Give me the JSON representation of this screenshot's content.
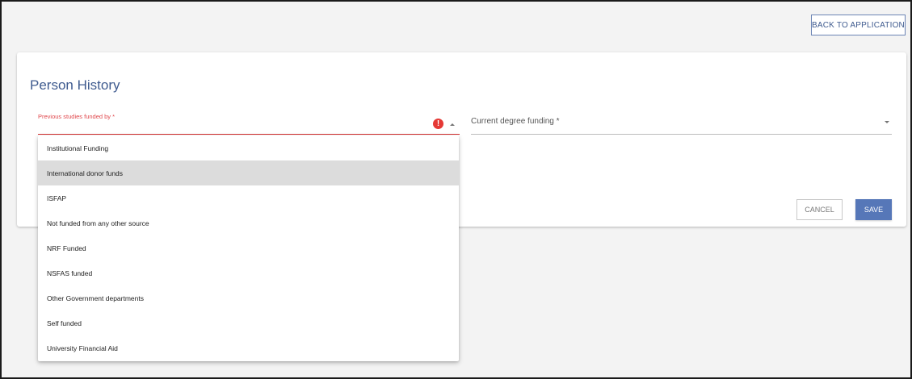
{
  "header": {
    "back_label": "BACK TO APPLICATION"
  },
  "form": {
    "title": "Person History",
    "previous_funding": {
      "label": "Previous studies funded by *",
      "error_icon": "exclamation-icon",
      "options": [
        "Institutional Funding",
        "International donor funds",
        "ISFAP",
        "Not funded from any other source",
        "NRF Funded",
        "NSFAS funded",
        "Other Government departments",
        "Self funded",
        "University Financial Aid"
      ],
      "highlighted_index": 1
    },
    "current_funding": {
      "label": "Current degree funding *"
    },
    "cancel_label": "CANCEL",
    "save_label": "SAVE"
  },
  "colors": {
    "accent": "#3f5b8f",
    "primary_button": "#5677b8",
    "error": "#e53935",
    "highlight": "#dcdcdc"
  }
}
